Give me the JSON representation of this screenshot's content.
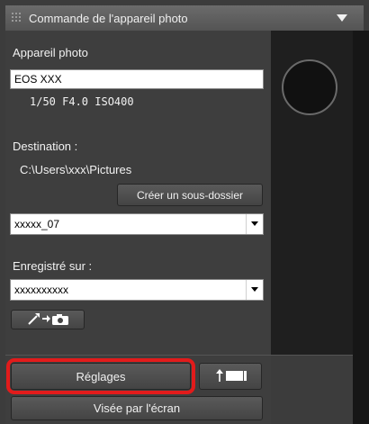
{
  "window": {
    "title": "Commande de l'appareil photo"
  },
  "camera": {
    "section_label": "Appareil photo",
    "model": "EOS XXX",
    "exposure": "1/50  F4.0  ISO400"
  },
  "destination": {
    "label": "Destination :",
    "path": "C:\\Users\\xxx\\Pictures",
    "create_subfolder_label": "Créer un sous-dossier",
    "folder_value": "xxxxx_07"
  },
  "saved_on": {
    "label": "Enregistré sur :",
    "value": "xxxxxxxxxx"
  },
  "buttons": {
    "settings_label": "Réglages",
    "live_view_label": "Visée par l'écran"
  },
  "icons": {
    "collapse": "triangle-down-icon",
    "combo_arrow": "small-triangle-down-icon",
    "transfer": "wand-arrow-camera-icon",
    "upload": "arrow-up-monitor-icon",
    "grip": "grip-icon"
  },
  "colors": {
    "highlight": "#e21b1b"
  }
}
